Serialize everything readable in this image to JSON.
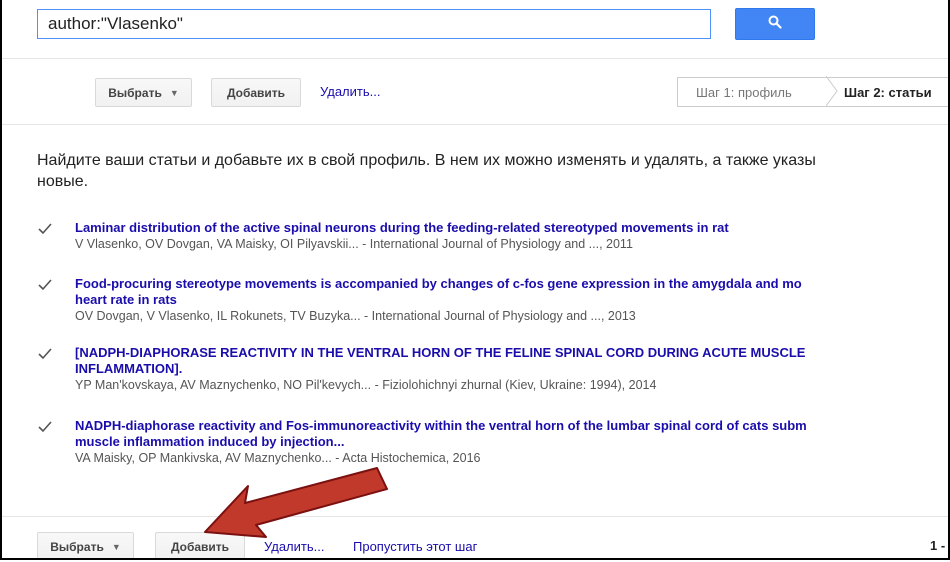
{
  "search": {
    "query": "author:\"Vlasenko\""
  },
  "toolbar_top": {
    "select_label": "Выбрать",
    "add_label": "Добавить",
    "delete_label": "Удалить..."
  },
  "steps": {
    "step1_label": "Шаг 1: профиль",
    "step2_label": "Шаг 2: статьи"
  },
  "intro": {
    "line1": "Найдите ваши статьи и добавьте их в свой профиль. В нем их можно изменять и удалять, а также указы",
    "line2": "новые."
  },
  "articles": [
    {
      "title_lines": [
        "Laminar distribution of the active spinal neurons during the feeding-related stereotyped movements in rat"
      ],
      "meta": "V Vlasenko, OV Dovgan, VA Maisky, OI Pilyavskii... - International Journal of Physiology and ..., 2011",
      "checked": true
    },
    {
      "title_lines": [
        "Food-procuring stereotype movements is accompanied by changes of c-fos gene expression in the amygdala and mo",
        "heart rate in rats"
      ],
      "meta": "OV Dovgan, V Vlasenko, IL Rokunets, TV Buzyka... - International Journal of Physiology and ..., 2013",
      "checked": true
    },
    {
      "title_lines": [
        "[NADPH-DIAPHORASE REACTIVITY IN THE VENTRAL HORN OF THE FELINE SPINAL CORD DURING ACUTE MUSCLE",
        "INFLAMMATION]."
      ],
      "meta": "YP Man'kovskaya, AV Maznychenko, NO Pil'kevych... - Fiziolohichnyi zhurnal (Kiev, Ukraine: 1994), 2014",
      "checked": true
    },
    {
      "title_lines": [
        "NADPH-diaphorase reactivity and Fos-immunoreactivity within the ventral horn of the lumbar spinal cord of cats subm",
        "muscle inflammation induced by injection..."
      ],
      "meta": "VA Maisky, OP Mankivska, AV Maznychenko... - Acta Histochemica, 2016",
      "checked": true
    }
  ],
  "toolbar_bottom": {
    "select_label": "Выбрать",
    "add_label": "Добавить",
    "delete_label": "Удалить...",
    "skip_label": "Пропустить этот шаг",
    "page_indicator": "1 -"
  },
  "icons": {
    "search": "search-icon",
    "checkbox": "checkmark-icon",
    "annotation": "red-arrow-annotation"
  },
  "colors": {
    "accent_blue": "#4285f4",
    "link": "#1a0dab",
    "arrow_red": "#b31b1b"
  }
}
